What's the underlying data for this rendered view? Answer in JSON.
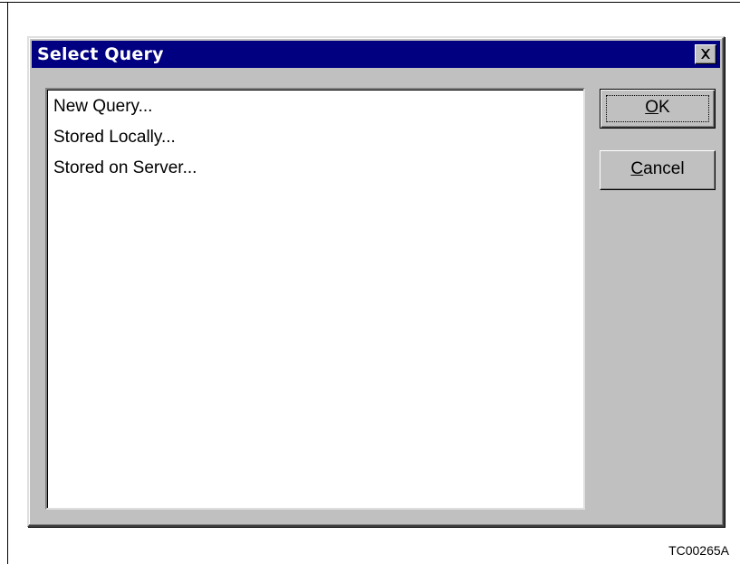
{
  "dialog": {
    "title": "Select Query",
    "close_icon": "close-x-icon"
  },
  "list": {
    "items": [
      {
        "label": "New Query..."
      },
      {
        "label": "Stored Locally..."
      },
      {
        "label": "Stored on Server..."
      }
    ]
  },
  "buttons": {
    "ok": {
      "mnemonic": "O",
      "rest": "K"
    },
    "cancel": {
      "mnemonic": "C",
      "rest": "ancel"
    }
  },
  "figure_id": "TC00265A",
  "colors": {
    "titlebar": "#000080",
    "face": "#c0c0c0"
  }
}
